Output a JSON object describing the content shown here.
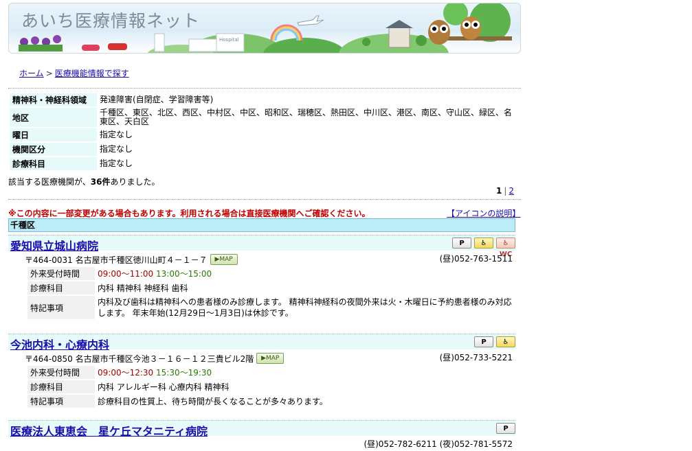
{
  "site": {
    "title": "あいち医療情報ネット",
    "hospital_sign": "Hospital"
  },
  "breadcrumb": {
    "home": "ホーム",
    "sep": ">",
    "current": "医療機能情報で探す"
  },
  "criteria": [
    {
      "label": "精神科・神経科領域",
      "value": "発達障害(自閉症、学習障害等)"
    },
    {
      "label": "地区",
      "value": "千種区、東区、北区、西区、中村区、中区、昭和区、瑞穂区、熱田区、中川区、港区、南区、守山区、緑区、名東区、天白区"
    },
    {
      "label": "曜日",
      "value": "指定なし"
    },
    {
      "label": "機関区分",
      "value": "指定なし"
    },
    {
      "label": "診療科目",
      "value": "指定なし"
    }
  ],
  "result": {
    "prefix": "該当する医療機関が、",
    "count": "36件",
    "suffix": "ありました。"
  },
  "pager": {
    "current": "1",
    "sep": "|",
    "next": "2"
  },
  "notice": "※この内容に一部変更がある場合もあります。利用される場合は直接医療機関へご確認ください。",
  "icon_help": "【アイコンの説明】",
  "ward": "千種区",
  "labels": {
    "hours": "外来受付時間",
    "departments": "診療科目",
    "notes": "特記事項",
    "map": "▶MAP"
  },
  "icons": {
    "parking": "P",
    "wheelchair": "♿",
    "wc": "♿WC"
  },
  "facilities": [
    {
      "name": "愛知県立城山病院",
      "address": "〒464-0031 名古屋市千種区徳川山町４－１－７",
      "phone": "(昼)052-763-1511",
      "hours_am": "09:00～11:00",
      "hours_pm": "13:00～15:00",
      "departments": "内科 精神科 神経科 歯科",
      "notes": "内科及び歯科は精神科への患者様のみ診療します。 精神科神経科の夜間外来は火・木曜日に予約患者様のみ対応します。 年末年始(12月29日～1月3日)は休診です。",
      "icons": [
        "parking",
        "wheelchair",
        "wc"
      ]
    },
    {
      "name": "今池内科・心療内科",
      "address": "〒464-0850 名古屋市千種区今池３－１６－１２三貴ビル2階",
      "phone": "(昼)052-733-5221",
      "hours_am": "09:00～12:30",
      "hours_pm": "15:30～19:30",
      "departments": "内科 アレルギー科 心療内科 精神科",
      "notes": "診療科目の性質上、待ち時間が長くなることが多々あります。",
      "icons": [
        "parking",
        "wheelchair"
      ]
    },
    {
      "name": "医療法人東恵会　星ケ丘マタニティ病院",
      "phone": "(昼)052-782-6211 (夜)052-781-5572",
      "icons": [
        "parking"
      ]
    }
  ]
}
